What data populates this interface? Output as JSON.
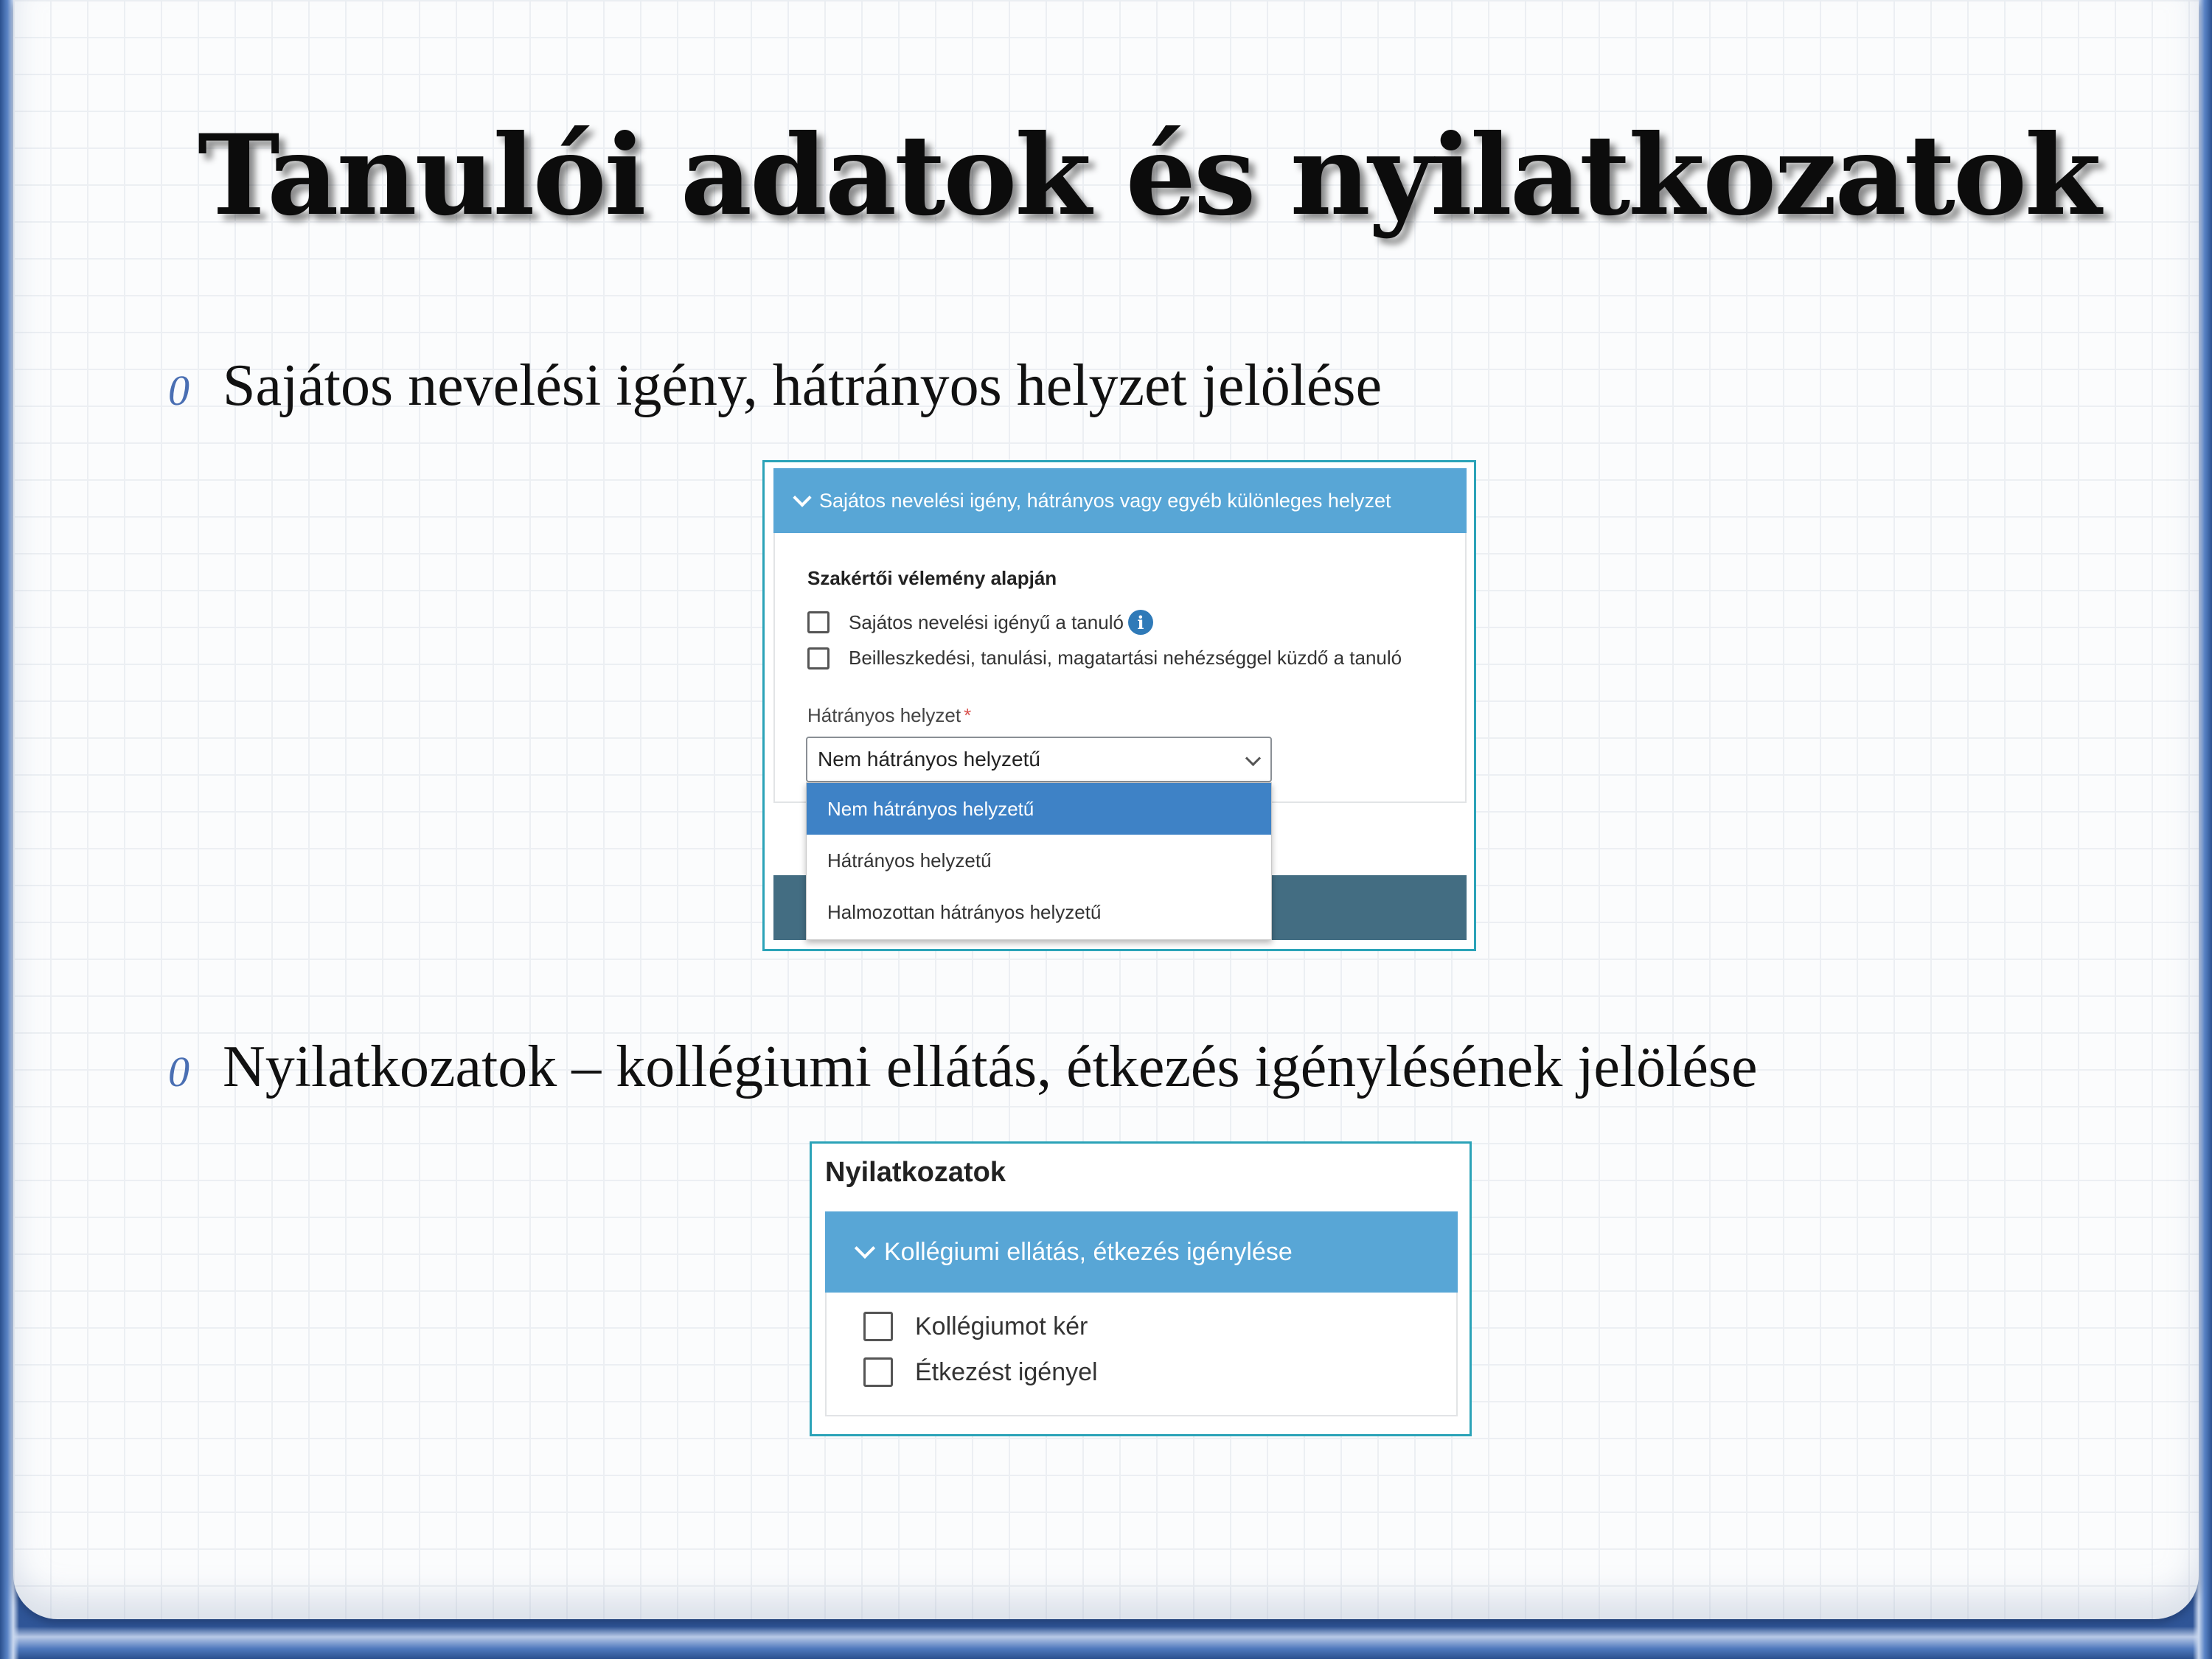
{
  "title": "Tanulói adatok és nyilatkozatok",
  "bullet_glyph": "0",
  "bullets": [
    "Sajátos nevelési igény, hátrányos helyzet jelölése",
    "Nyilatkozatok – kollégiumi ellátás, étkezés igénylésének jelölése"
  ],
  "screenshot1": {
    "section_header": "Sajátos nevelési igény, hátrányos vagy egyéb különleges helyzet",
    "subtitle": "Szakértői vélemény alapján",
    "checkboxes": [
      {
        "label": "Sajátos nevelési igényű a tanuló",
        "checked": false
      },
      {
        "label": "Beilleszkedési, tanulási, magatartási nehézséggel küzdő a tanuló",
        "checked": false
      }
    ],
    "info_glyph": "i",
    "field_label": "Hátrányos helyzet",
    "required_mark": "*",
    "select_value": "Nem hátrányos helyzetű",
    "options": [
      "Nem hátrányos helyzetű",
      "Hátrányos helyzetű",
      "Halmozottan hátrányos helyzetű"
    ],
    "selected_option": "Nem hátrányos helyzetű"
  },
  "screenshot2": {
    "title": "Nyilatkozatok",
    "section_header": "Kollégiumi ellátás, étkezés igénylése",
    "checkboxes": [
      {
        "label": "Kollégiumot kér",
        "checked": false
      },
      {
        "label": "Étkezést igényel",
        "checked": false
      }
    ]
  },
  "colors": {
    "accent_header": "#58a6d6",
    "selected_option": "#3e82c6",
    "dark_bar": "#436d82",
    "frame": "#2ba3b8",
    "slide_border": "#2f5597"
  }
}
